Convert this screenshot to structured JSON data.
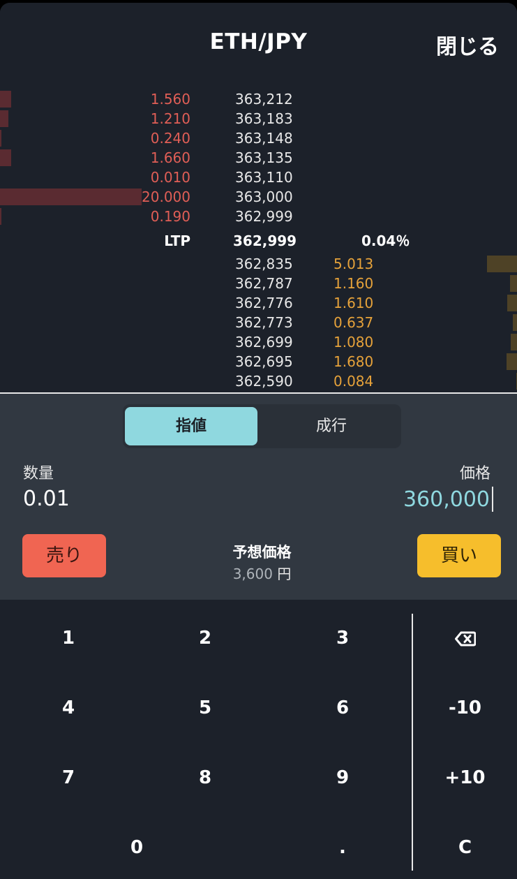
{
  "header": {
    "title": "ETH/JPY",
    "close_label": "閉じる"
  },
  "orderbook": {
    "asks": [
      {
        "qty": "1.560",
        "price": "363,212",
        "depth": 0.08
      },
      {
        "qty": "1.210",
        "price": "363,183",
        "depth": 0.06
      },
      {
        "qty": "0.240",
        "price": "363,148",
        "depth": 0.01
      },
      {
        "qty": "1.660",
        "price": "363,135",
        "depth": 0.08
      },
      {
        "qty": "0.010",
        "price": "363,110",
        "depth": 0.0
      },
      {
        "qty": "20.000",
        "price": "363,000",
        "depth": 1.0
      },
      {
        "qty": "0.190",
        "price": "362,999",
        "depth": 0.01
      }
    ],
    "ltp": {
      "label": "LTP",
      "price": "362,999",
      "change": "0.04％"
    },
    "bids": [
      {
        "price": "362,835",
        "qty": "5.013",
        "depth": 1.0
      },
      {
        "price": "362,787",
        "qty": "1.160",
        "depth": 0.23
      },
      {
        "price": "362,776",
        "qty": "1.610",
        "depth": 0.32
      },
      {
        "price": "362,773",
        "qty": "0.637",
        "depth": 0.13
      },
      {
        "price": "362,699",
        "qty": "1.080",
        "depth": 0.22
      },
      {
        "price": "362,695",
        "qty": "1.680",
        "depth": 0.34
      },
      {
        "price": "362,590",
        "qty": "0.084",
        "depth": 0.02
      }
    ]
  },
  "order": {
    "tabs": {
      "limit": "指値",
      "market": "成行"
    },
    "quantity_label": "数量",
    "quantity_value": "0.01",
    "price_label": "価格",
    "price_value": "360,000",
    "sell_label": "売り",
    "buy_label": "買い",
    "estimate_label": "予想価格",
    "estimate_value": "3,600",
    "estimate_unit": "円"
  },
  "keypad": {
    "digits": [
      "1",
      "2",
      "3",
      "4",
      "5",
      "6",
      "7",
      "8",
      "9",
      "0",
      "."
    ],
    "minus10": "-10",
    "plus10": "+10",
    "clear": "C"
  },
  "colors": {
    "ask": "#e05e56",
    "bid": "#e6a23a",
    "accent": "#8fd8df",
    "sell": "#f06552",
    "buy": "#f6be2c"
  }
}
